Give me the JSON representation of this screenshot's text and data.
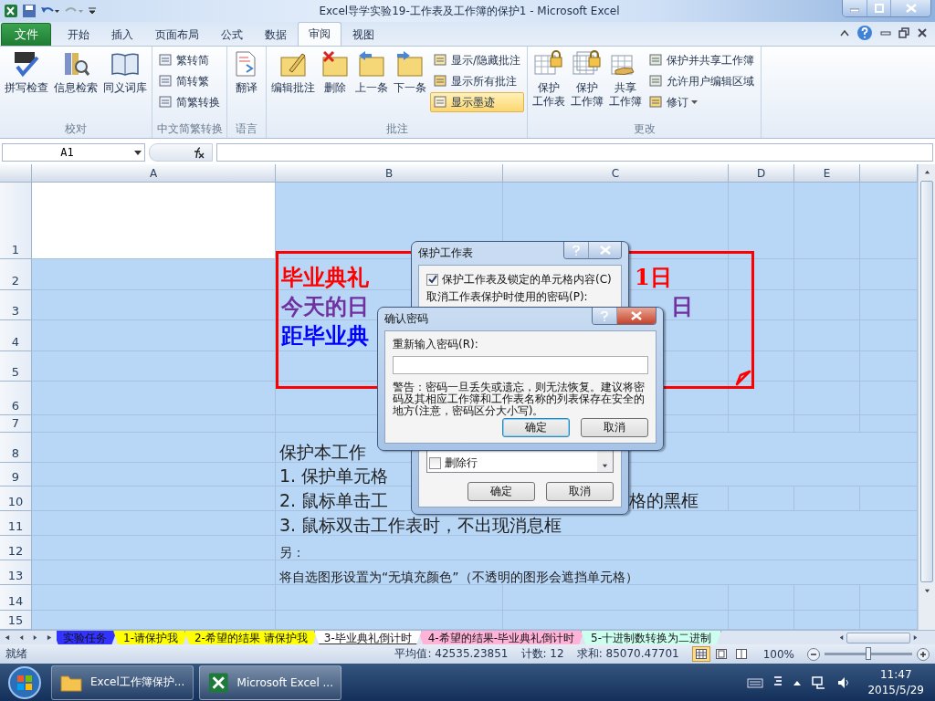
{
  "window": {
    "title": "Excel导学实验19-工作表及工作簿的保护1 - Microsoft Excel"
  },
  "ribbon_tabs": [
    {
      "label": "文件",
      "kind": "file",
      "selected": false
    },
    {
      "label": "开始",
      "kind": "tab",
      "selected": false
    },
    {
      "label": "插入",
      "kind": "tab",
      "selected": false
    },
    {
      "label": "页面布局",
      "kind": "tab",
      "selected": false
    },
    {
      "label": "公式",
      "kind": "tab",
      "selected": false
    },
    {
      "label": "数据",
      "kind": "tab",
      "selected": false
    },
    {
      "label": "审阅",
      "kind": "tab",
      "selected": true
    },
    {
      "label": "视图",
      "kind": "tab",
      "selected": false
    }
  ],
  "ribbon_groups": [
    {
      "label": "校对",
      "buttons": [
        {
          "kind": "large",
          "label": "拼写检查"
        },
        {
          "kind": "large",
          "label": "信息检索"
        },
        {
          "kind": "large",
          "label": "同义词库"
        }
      ]
    },
    {
      "label": "中文简繁转换",
      "buttons": [
        {
          "kind": "small",
          "label": "繁转简"
        },
        {
          "kind": "small",
          "label": "简转繁"
        },
        {
          "kind": "small",
          "label": "简繁转换"
        }
      ]
    },
    {
      "label": "语言",
      "buttons": [
        {
          "kind": "large",
          "label": "翻译"
        }
      ]
    },
    {
      "label": "批注",
      "buttons": [
        {
          "kind": "large",
          "label": "编辑批注"
        },
        {
          "kind": "large",
          "label": "删除"
        },
        {
          "kind": "large",
          "label": "上一条"
        },
        {
          "kind": "large",
          "label": "下一条"
        },
        {
          "kind": "toggle",
          "label": "显示/隐藏批注",
          "on": false
        },
        {
          "kind": "toggle",
          "label": "显示所有批注",
          "on": false
        },
        {
          "kind": "toggle",
          "label": "显示墨迹",
          "on": true
        }
      ]
    },
    {
      "label": "更改",
      "buttons": [
        {
          "kind": "large",
          "lines": [
            "保护",
            "工作表"
          ]
        },
        {
          "kind": "large",
          "lines": [
            "保护",
            "工作簿"
          ]
        },
        {
          "kind": "large",
          "lines": [
            "共享",
            "工作簿"
          ]
        },
        {
          "kind": "small",
          "label": "保护并共享工作簿"
        },
        {
          "kind": "small",
          "label": "允许用户编辑区域"
        },
        {
          "kind": "menu",
          "label": "修订"
        }
      ]
    }
  ],
  "formula_bar": {
    "name_box": "A1"
  },
  "columns": [
    "A",
    "B",
    "C",
    "D",
    "E"
  ],
  "rows": [
    "1",
    "2",
    "3",
    "4",
    "5",
    "6",
    "7",
    "8",
    "9",
    "10",
    "11",
    "12",
    "13",
    "14",
    "15"
  ],
  "shape": {
    "lines": [
      {
        "left": "毕业典礼",
        "right": "1日",
        "color": "#ff0000"
      },
      {
        "left": "今天的日",
        "right": "日",
        "color": "#7030a0"
      },
      {
        "left": "距毕业典",
        "color": "#0000ff"
      }
    ]
  },
  "sheet_text": [
    {
      "kind": "large",
      "text": "保护本工作"
    },
    {
      "kind": "large",
      "text": "1.  保护单元格"
    },
    {
      "kind": "large",
      "text": "2.  鼠标单击工",
      "right": "格的黑框"
    },
    {
      "kind": "large",
      "text": "3.  鼠标双击工作表时，不出现消息框"
    },
    {
      "kind": "small",
      "text": "另："
    },
    {
      "kind": "small",
      "text": "将自选图形设置为“无填充颜色”（不透明的图形会遮挡单元格）"
    }
  ],
  "sheet_tabs": [
    {
      "label": "实验任务",
      "color": "#3333ff",
      "selected": false
    },
    {
      "label": "1-请保护我",
      "color": "#ffff00",
      "selected": false
    },
    {
      "label": "2-希望的结果 请保护我",
      "color": "#ffff00",
      "selected": false
    },
    {
      "label": "3-毕业典礼倒计时",
      "color": "#ffffff",
      "selected": true
    },
    {
      "label": "4-希望的结果-毕业典礼倒计时",
      "color": "#ffb3d9",
      "selected": false
    },
    {
      "label": "5-十进制数转换为二进制",
      "color": "#ccffee",
      "selected": false
    }
  ],
  "status_bar": {
    "ready": "就绪",
    "average": "平均值: 42535.23851",
    "count": "计数: 12",
    "sum": "求和: 85070.47701",
    "views": [
      {
        "selected": true
      },
      {
        "selected": false
      },
      {
        "selected": false
      }
    ],
    "zoom": "100%",
    "zoom_slider": {
      "level": 0.5
    }
  },
  "protect_dialog": {
    "title": "保护工作表",
    "protect_checkbox": {
      "label": "保护工作表及锁定的单元格内容(C)",
      "checked": true
    },
    "password_label": "取消工作表保护时使用的密码(P):",
    "permissions": [
      {
        "label": "删除行",
        "checked": false
      }
    ],
    "buttons": [
      {
        "label": "确定",
        "selected": false
      },
      {
        "label": "取消",
        "selected": false
      }
    ]
  },
  "confirm_dialog": {
    "title": "确认密码",
    "label": "重新输入密码(R):",
    "warning": "警告：密码一旦丢失或遗忘，则无法恢复。建议将密码及其相应工作簿和工作表名称的列表保存在安全的地方(注意，密码区分大小写)。",
    "buttons": [
      {
        "label": "确定",
        "selected": true
      },
      {
        "label": "取消",
        "selected": false
      }
    ]
  },
  "taskbar": {
    "tasks": [
      {
        "label": "Excel工作簿保护...",
        "selected": false
      },
      {
        "label": "Microsoft Excel ...",
        "selected": true
      }
    ],
    "time": "11:47",
    "date": "2015/5/29"
  }
}
